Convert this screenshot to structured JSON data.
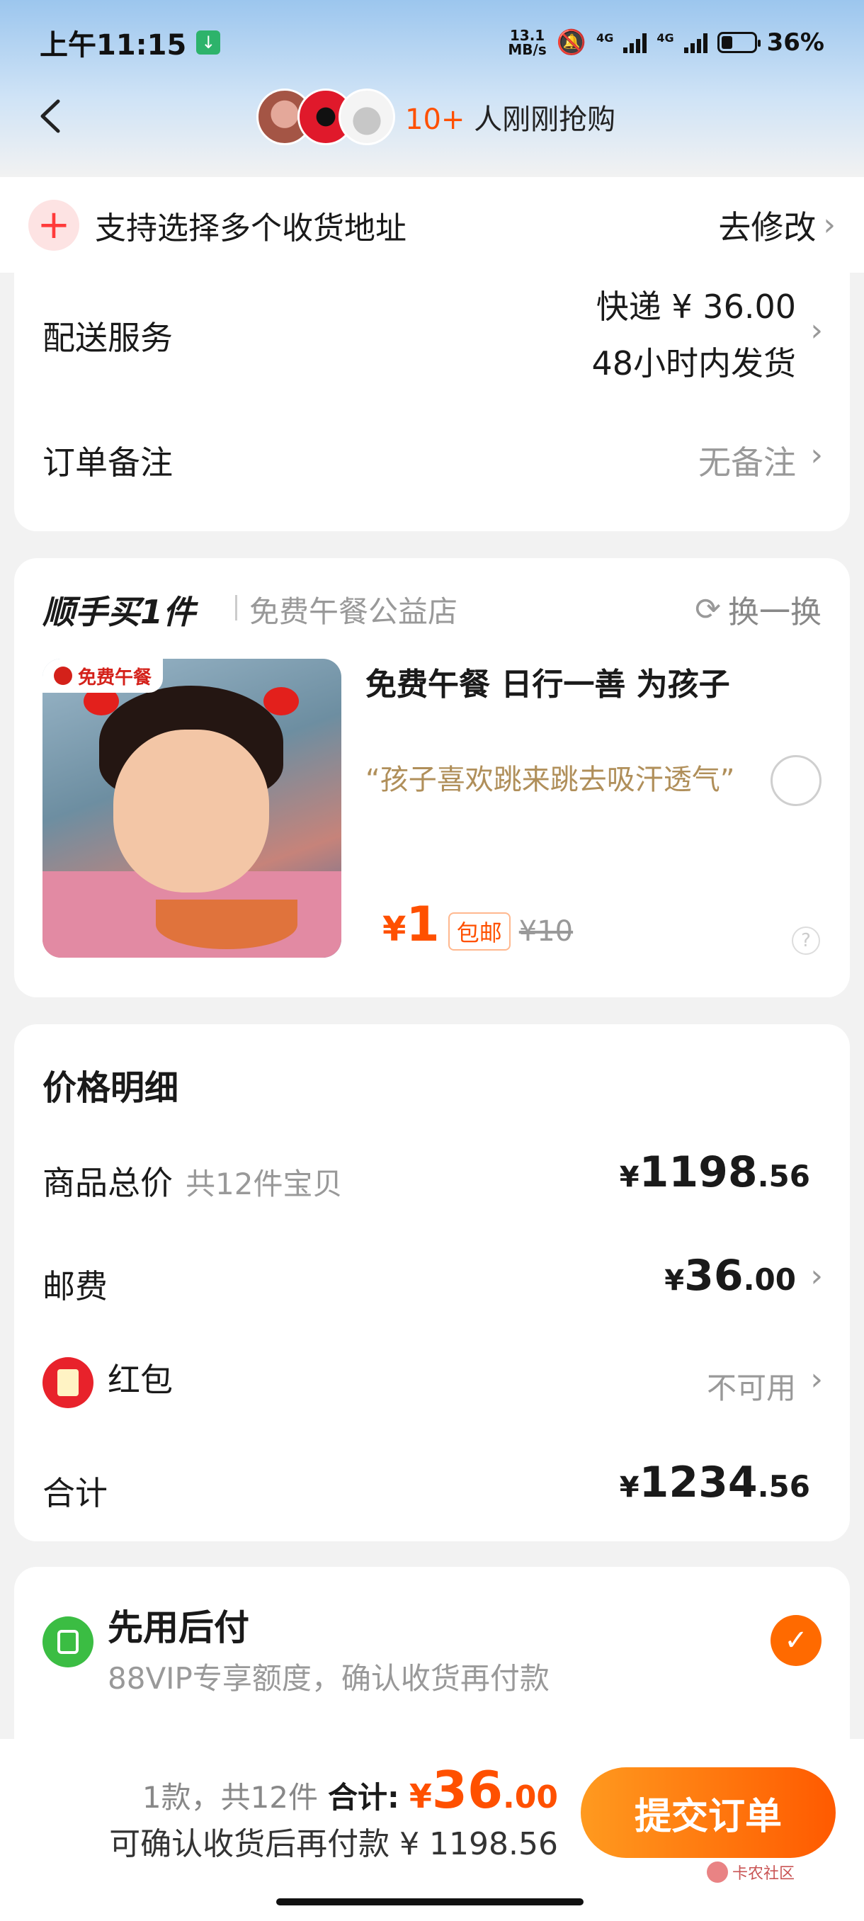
{
  "status_bar": {
    "time": "上午11:15",
    "net_speed_value": "13.1",
    "net_speed_unit": "MB/s",
    "net_type_1": "4G",
    "net_type_2": "4G",
    "battery_percent": "36%"
  },
  "header": {
    "buyers_count": "10+",
    "buyers_text": " 人刚刚抢购"
  },
  "multi_address": {
    "text": "支持选择多个收货地址",
    "action": "去修改"
  },
  "delivery": {
    "label": "配送服务",
    "shipping_line": "快递 ¥ 36.00",
    "dispatch_line": "48小时内发货",
    "remark_label": "订单备注",
    "remark_value": "无备注"
  },
  "upsell": {
    "title": "顺手买1件",
    "shop_name": "免费午餐公益店",
    "swap_label": "换一换",
    "image_badge": "免费午餐",
    "product_title": "免费午餐 日行一善 为孩子",
    "product_quote": "“孩子喜欢跳来跳去吸汗透气”",
    "currency": "¥",
    "price": "1",
    "free_shipping_tag": "包邮",
    "original_price": "¥10",
    "help_icon_text": "?"
  },
  "price_detail": {
    "title": "价格明细",
    "goods_label": "商品总价",
    "goods_sub": "共12件宝贝",
    "goods_yen": "¥",
    "goods_int": "1198",
    "goods_dec": ".56",
    "shipping_label": "邮费",
    "shipping_yen": "¥",
    "shipping_int": "36",
    "shipping_dec": ".00",
    "red_packet_label": "红包",
    "red_packet_value": "不可用",
    "total_label": "合计",
    "total_yen": "¥",
    "total_int": "1234",
    "total_dec": ".56"
  },
  "pay_later": {
    "title": "先用后付",
    "desc": "88VIP专享额度，确认收货再付款"
  },
  "bottom_bar": {
    "count_text": "1款，共12件",
    "total_label": "合计:",
    "total_yen": "¥",
    "total_int": "36",
    "total_dec": ".00",
    "pay_after_text": "可确认收货后再付款 ¥ 1198.56",
    "submit_label": "提交订单",
    "watermark_text": "卡农社区"
  },
  "colors": {
    "accent": "#ff5000",
    "submit_start": "#ff9a1f",
    "submit_end": "#ff5a00",
    "pay_later_green": "#3bbd43",
    "red_packet_red": "#e8222b"
  }
}
